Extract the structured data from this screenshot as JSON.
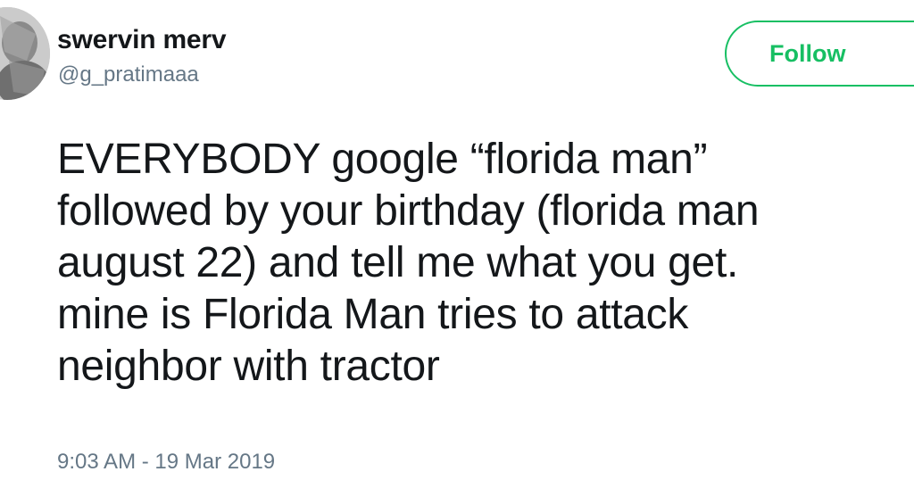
{
  "user": {
    "display_name": "swervin merv",
    "handle": "@g_pratimaaa"
  },
  "follow_button": {
    "label": "Follow"
  },
  "tweet": {
    "lines": [
      "EVERYBODY google “florida man”",
      "followed by your birthday (florida man",
      "august 22) and tell me what you get.",
      "mine is Florida Man tries to attack",
      "neighbor with tractor"
    ],
    "timestamp": "9:03 AM - 19 Mar 2019"
  },
  "colors": {
    "accent": "#17bf63",
    "text": "#14171a",
    "muted": "#657786"
  },
  "icons": {
    "avatar": "avatar-photo"
  }
}
